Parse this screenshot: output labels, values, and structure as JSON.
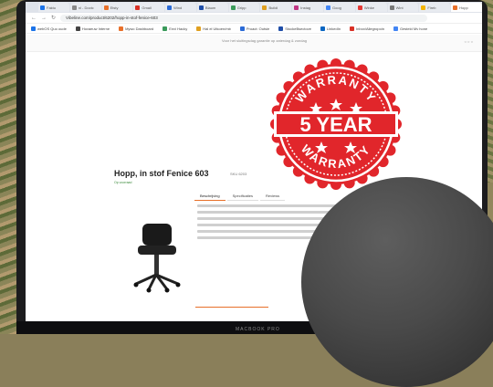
{
  "browser": {
    "tabs": [
      "Faktu",
      "nl - Doctc",
      "Etsty",
      "Gmail",
      "Wind",
      "Blaum",
      "Gripp",
      "Buildi",
      "Instag",
      "Goog",
      "Winke",
      "Wint",
      "Fireb",
      "Hopp"
    ],
    "url": "Vibeline.com/product/6202/hopp-in-stof-fenice-603",
    "bookmarks": [
      "webOS Quo oude",
      "Hovaeuw Interne",
      "Mywo Dashboard",
      "Envi Hacky",
      "Hal el Utkoen/mb",
      "Proact: Outsie",
      "StockeBsectove",
      "LinkedIn",
      "Inbox/Allegropoin",
      "Gesteld Mv hone"
    ]
  },
  "site": {
    "promo_strip": "Voor het sluitingsdag garantie op zaterdag & zondag"
  },
  "product": {
    "title": "Hopp, in stof Fenice 603",
    "code": "SKU 6203",
    "stock": "Op voorraad"
  },
  "tabs": [
    "Beschrijving",
    "Specificaties",
    "Reviews"
  ],
  "seal": {
    "top": "WARRANTY",
    "main": "5 YEAR",
    "bottom": "WARRANTY",
    "color": "#e1262b"
  },
  "laptop_brand": "MACBOOK PRO"
}
